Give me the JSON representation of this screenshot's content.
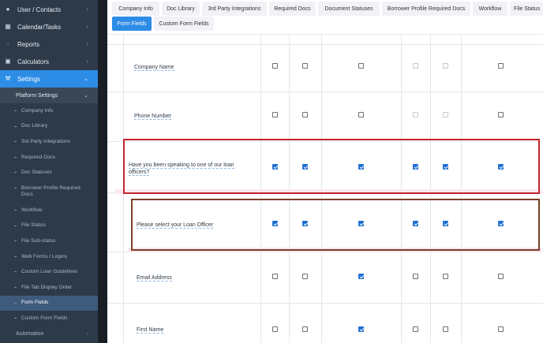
{
  "sidebar": {
    "items": [
      {
        "label": "User / Contacts",
        "icon": "user-icon"
      },
      {
        "label": "Calendar/Tasks",
        "icon": "calendar-icon"
      },
      {
        "label": "Reports",
        "icon": "reports-icon"
      },
      {
        "label": "Calculators",
        "icon": "calculator-icon"
      },
      {
        "label": "Settings",
        "icon": "wrench-icon"
      }
    ],
    "submenu": {
      "label": "Platform Settings"
    },
    "leaves": [
      "Company Info",
      "Doc Library",
      "3rd Party Integrations",
      "Required Docs",
      "Doc Statuses",
      "Borrower Profile Required Docs",
      "Workflow",
      "File Status",
      "File Sub-status",
      "Web Forms / Logins",
      "Custom Loan Guidelines",
      "File Tab Display Order",
      "Form Fields",
      "Custom Form Fields"
    ],
    "active_leaf": "Form Fields",
    "bottom": {
      "label": "Automation"
    }
  },
  "tabs": [
    "Company Info",
    "Doc Library",
    "3rd Party Integrations",
    "Required Docs",
    "Document Statuses",
    "Borrower Profile Required Docs",
    "Workflow",
    "File Status",
    "Form Fields",
    "Custom Form Fields"
  ],
  "active_tab": "Form Fields",
  "table": {
    "rows": [
      {
        "label": "Company Name",
        "checks": [
          false,
          false,
          false,
          false,
          false,
          false
        ],
        "dim": [
          false,
          false,
          false,
          true,
          true,
          false
        ]
      },
      {
        "label": "Phone Number",
        "checks": [
          false,
          false,
          false,
          false,
          false,
          false
        ],
        "dim": [
          false,
          false,
          false,
          true,
          true,
          false
        ]
      },
      {
        "label": "Have you been speaking to one of our loan officers?",
        "checks": [
          true,
          true,
          true,
          true,
          true,
          true
        ],
        "dim": [
          false,
          false,
          false,
          false,
          false,
          false
        ]
      },
      {
        "label": "Please select your Loan Officer",
        "checks": [
          true,
          true,
          true,
          true,
          true,
          true
        ],
        "dim": [
          false,
          false,
          false,
          false,
          false,
          false
        ]
      },
      {
        "label": "Email Address",
        "checks": [
          false,
          false,
          true,
          false,
          false,
          false
        ],
        "dim": [
          false,
          false,
          false,
          false,
          false,
          false
        ]
      },
      {
        "label": "First Name",
        "checks": [
          false,
          false,
          true,
          false,
          false,
          false
        ],
        "dim": [
          false,
          false,
          false,
          false,
          false,
          false
        ]
      }
    ]
  },
  "colors": {
    "sidebar_bg": "#2d3a4a",
    "accent": "#2d8ce6",
    "highlight_red": "#c0262c",
    "highlight_brown": "#7a3f24",
    "checkbox_checked": "#1f6fd1"
  }
}
